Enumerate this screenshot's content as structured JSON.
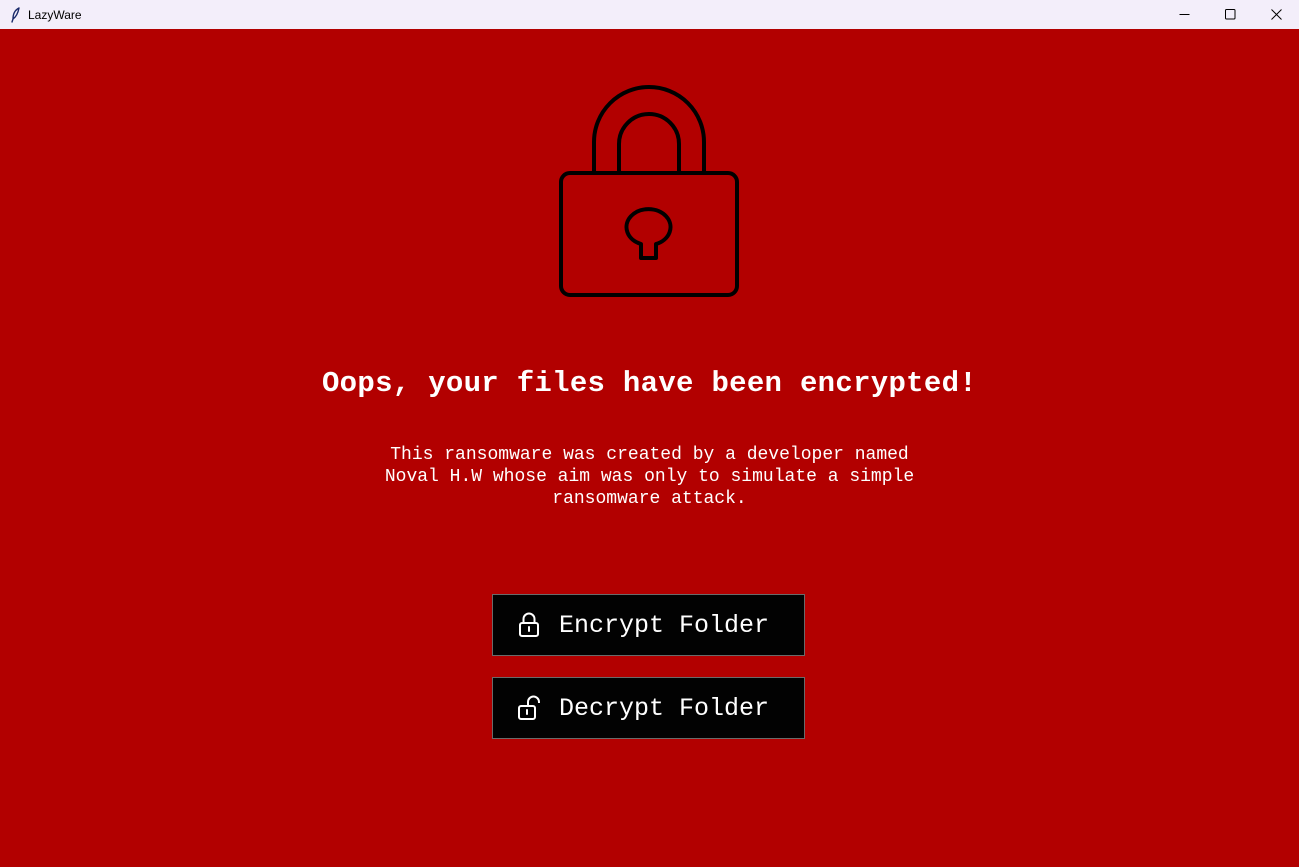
{
  "window": {
    "title": "LazyWare",
    "app_icon": "feather-icon",
    "controls": [
      "minimize-icon",
      "maximize-icon",
      "close-icon"
    ]
  },
  "colors": {
    "background": "#b20000",
    "titlebar": "#f3eefa",
    "button_bg": "#020202",
    "text": "#ffffff"
  },
  "hero": {
    "icon": "padlock-icon"
  },
  "main": {
    "headline": "Oops, your files have been encrypted!",
    "description_lines": [
      "This ransomware was created by a developer named",
      "Noval H.W whose aim was only to simulate a simple",
      "ransomware attack."
    ]
  },
  "actions": {
    "encrypt": {
      "label": "Encrypt Folder",
      "icon": "locked-padlock-icon"
    },
    "decrypt": {
      "label": "Decrypt Folder",
      "icon": "unlocked-padlock-icon"
    }
  }
}
